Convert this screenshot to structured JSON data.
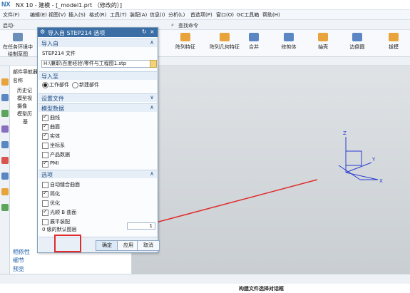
{
  "app": {
    "logo": "NX",
    "title": "NX 10 - 建模 - [_model1.prt （修改的）]"
  },
  "menu": [
    "文件(F)",
    "编辑(E)",
    "视图(V)",
    "插入(S)",
    "格式(R)",
    "工具(T)",
    "装配(A)",
    "信息(I)",
    "分析(L)",
    "首选项(P)",
    "窗口(O)",
    "GC工具箱",
    "帮助(H)"
  ],
  "toolbar": {
    "start": "启动-",
    "search": "查找命令"
  },
  "ribbon": {
    "left_label_line1": "在任务环境中",
    "left_label_line2": "绘制草图",
    "buttons": [
      "阵列特征",
      "阵列几何特征",
      "合并",
      "修剪体",
      "抽壳",
      "边倒圆",
      "拔模"
    ]
  },
  "navigator": {
    "title": "部件导航器",
    "column": "名称",
    "items": [
      "历史记",
      "模型视",
      "摄像",
      "模型历",
      "基"
    ],
    "bottom": [
      "相依性",
      "细节",
      "预览"
    ]
  },
  "dialog": {
    "title": "导入自 STEP214 选项",
    "section_import_from": "导入自",
    "file_label": "STEP214 文件",
    "file_path": "H:\\兼职\\百度经验\\零件与工程图1.stp",
    "section_import_to": "导入至",
    "radio_work_part": "工作部件",
    "radio_new_part": "新建部件",
    "section_settings_file": "设置文件",
    "section_model_data": "模型数据",
    "model_data_items": [
      {
        "label": "曲线",
        "checked": true
      },
      {
        "label": "曲面",
        "checked": true
      },
      {
        "label": "实体",
        "checked": true
      },
      {
        "label": "坐标系",
        "checked": false
      },
      {
        "label": "产品数据",
        "checked": false
      },
      {
        "label": "PMI",
        "checked": true
      }
    ],
    "section_options": "选项",
    "option_items": [
      {
        "label": "自动缝合曲面",
        "checked": false
      },
      {
        "label": "简化",
        "checked": true
      },
      {
        "label": "优化",
        "checked": false
      },
      {
        "label": "光顺 B 曲面",
        "checked": true
      },
      {
        "label": "展平装配",
        "checked": false
      }
    ],
    "layer_label": "0 级的默认图层",
    "layer_value": "1",
    "btn_ok": "确定",
    "btn_apply": "应用",
    "btn_cancel": "取消"
  },
  "axis": {
    "x": "X",
    "y": "Y",
    "z": "Z"
  },
  "status": {
    "text": "构建文件选择对话框"
  },
  "colors": {
    "accent": "#3a6ea5",
    "highlight": "#e02b2b"
  }
}
